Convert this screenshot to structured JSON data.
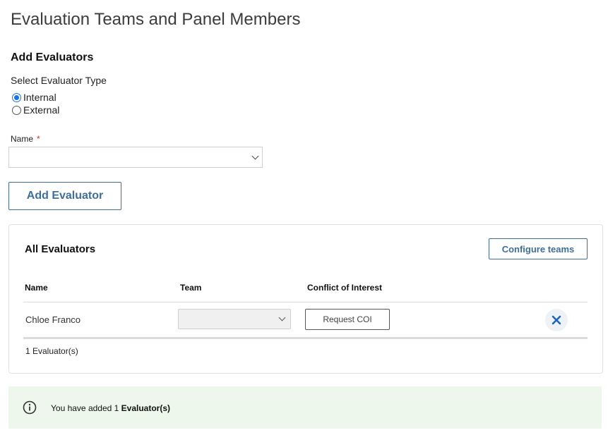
{
  "page": {
    "title": "Evaluation Teams and Panel Members"
  },
  "add_evaluators": {
    "heading": "Add Evaluators",
    "type_label": "Select Evaluator Type",
    "types": [
      {
        "label": "Internal",
        "selected": true
      },
      {
        "label": "External",
        "selected": false
      }
    ],
    "name_label": "Name",
    "required_marker": "*",
    "name_value": "",
    "add_button": "Add Evaluator"
  },
  "all_evaluators": {
    "heading": "All Evaluators",
    "configure_button": "Configure teams",
    "columns": [
      "Name",
      "Team",
      "Conflict of Interest"
    ],
    "rows": [
      {
        "name": "Chloe Franco",
        "team": "",
        "coi_button": "Request COI"
      }
    ],
    "count_text": "1 Evaluator(s)"
  },
  "info": {
    "prefix": "You have added 1 ",
    "bold": "Evaluator(s)"
  },
  "colors": {
    "accent": "#3e6f9a",
    "radio": "#1a73e8",
    "remove_icon": "#1f66b5",
    "info_bg": "#edf7ec",
    "required": "#c0392b"
  },
  "icons": {
    "chevron": "chevron-down-icon",
    "remove": "close-icon",
    "info": "info-icon"
  }
}
